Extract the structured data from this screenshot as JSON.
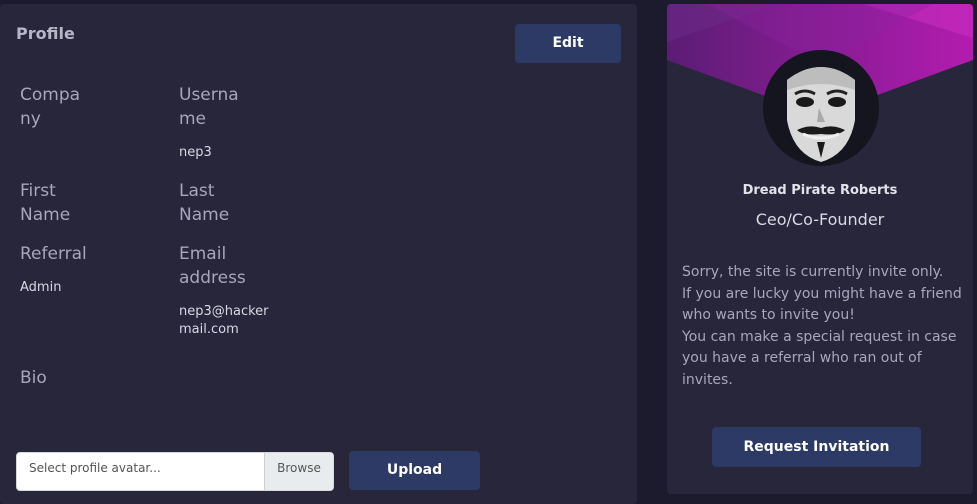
{
  "profile": {
    "title": "Profile",
    "edit_label": "Edit",
    "fields": {
      "company_label": "Compa\nny",
      "username_label": "Userna\nme",
      "username_value": "nep3",
      "first_name_label": "First\nName",
      "last_name_label": "Last\nName",
      "referral_label": "Referral",
      "referral_value": "Admin",
      "email_label": "Email\naddress",
      "email_value": "nep3@hacker\nmail.com",
      "bio_label": "Bio"
    },
    "avatar_input": {
      "placeholder": "Select profile avatar...",
      "browse_label": "Browse"
    },
    "upload_label": "Upload"
  },
  "side_card": {
    "avatar_icon": "guy-fawkes-mask-icon",
    "name": "Dread Pirate Roberts",
    "role": "Ceo/Co-Founder",
    "message": "Sorry, the site is currently invite only.\nIf you are lucky you might have a friend who wants to invite you!\nYou can make a special request in case you have a referral who ran out of invites.",
    "request_label": "Request Invitation"
  },
  "colors": {
    "background": "#1c1b2d",
    "card": "#27263b",
    "button": "#2d3a66",
    "banner_accent": "#b31cb0"
  }
}
